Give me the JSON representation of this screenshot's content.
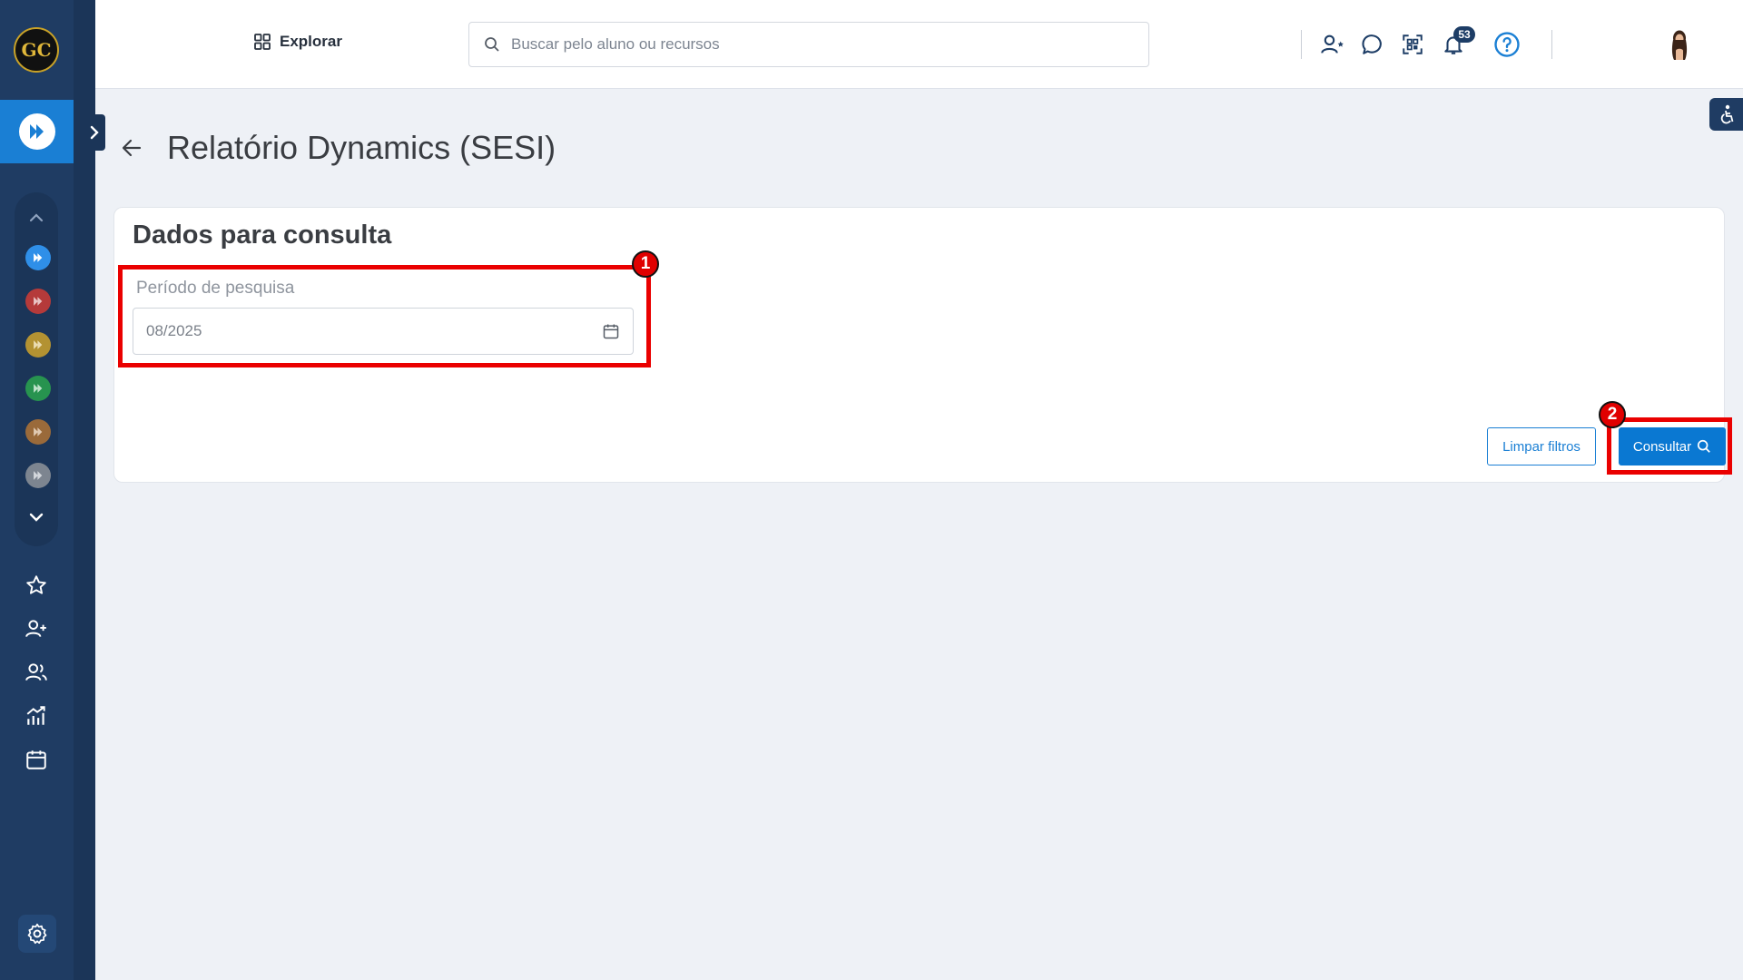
{
  "sidebar": {
    "logo_text": "GC",
    "modules": [
      {
        "name": "module-blue",
        "color": "#2f8fe8"
      },
      {
        "name": "module-red",
        "color": "#b53a3a"
      },
      {
        "name": "module-gold",
        "color": "#b39232"
      },
      {
        "name": "module-green",
        "color": "#27934f"
      },
      {
        "name": "module-brown",
        "color": "#9a6a3a"
      },
      {
        "name": "module-gray",
        "color": "#7d8590"
      }
    ],
    "icons": [
      "star-icon",
      "add-user-icon",
      "users-icon",
      "chart-icon",
      "calendar-icon"
    ]
  },
  "topbar": {
    "explore_label": "Explorar",
    "search_placeholder": "Buscar pelo aluno ou recursos",
    "notification_count": "53"
  },
  "page": {
    "title": "Relatório Dynamics (SESI)"
  },
  "card": {
    "title": "Dados para consulta",
    "period_label": "Período de pesquisa",
    "period_value": "08/2025",
    "clear_button": "Limpar filtros",
    "submit_button": "Consultar"
  },
  "annotations": [
    {
      "number": "1"
    },
    {
      "number": "2"
    }
  ],
  "colors": {
    "sidebar": "#1f3c63",
    "accent": "#1a7fd4",
    "annotation": "#ea0000"
  }
}
